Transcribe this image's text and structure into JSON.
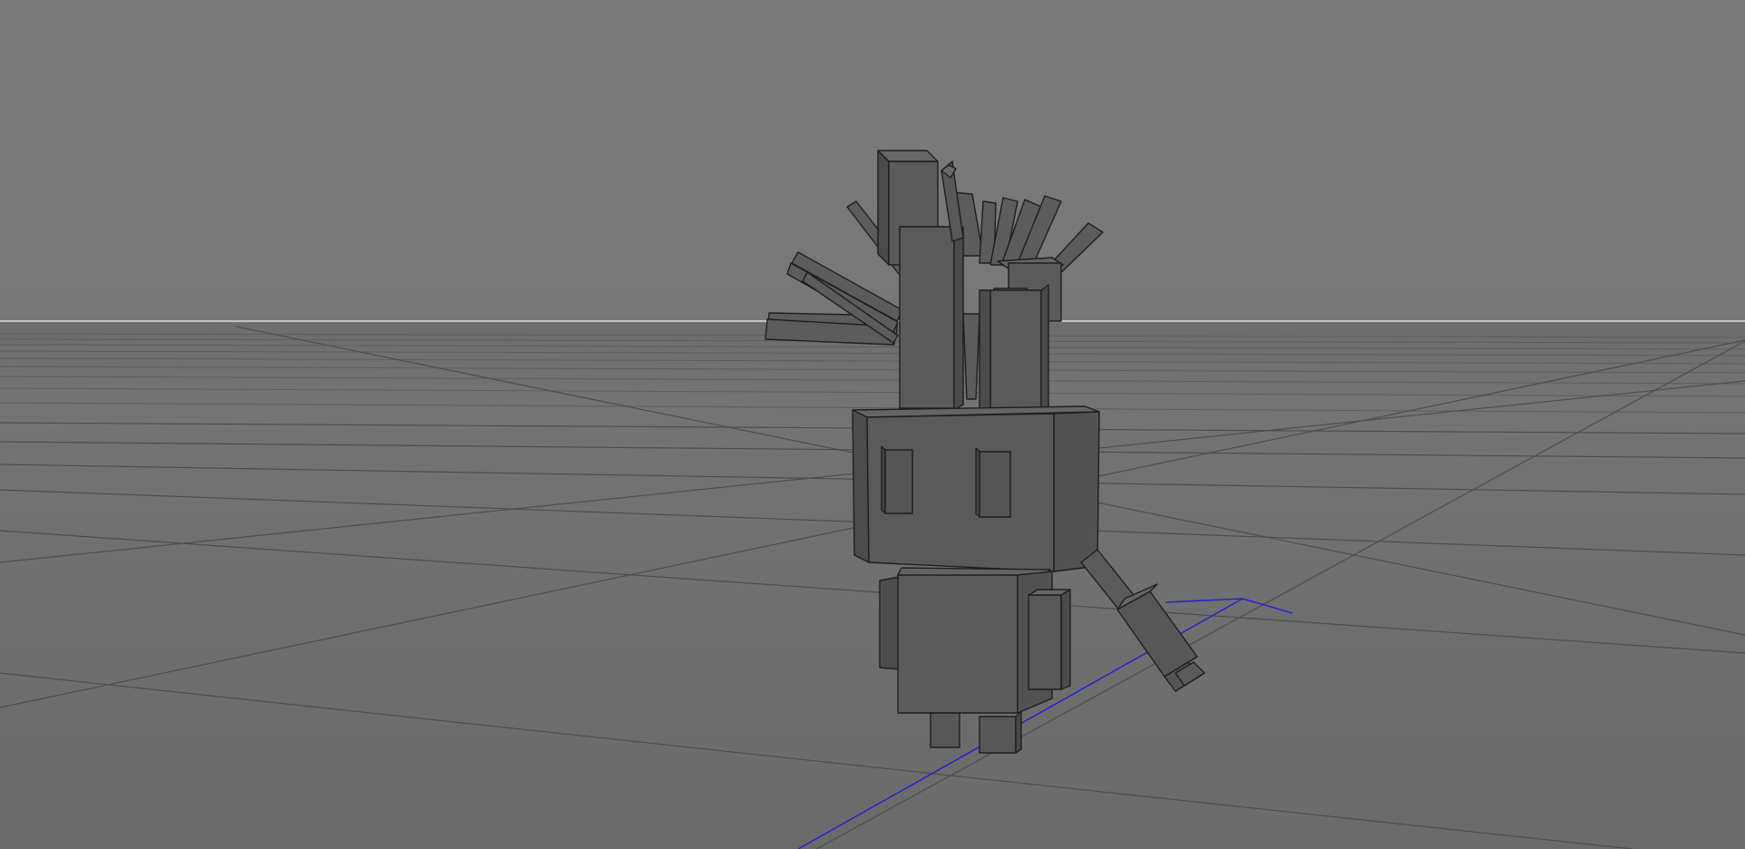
{
  "viewport": {
    "kind": "3d-viewport",
    "projection": "perspective",
    "background_top": "#7b7b7b",
    "background_bottom": "#6c6c6c",
    "horizon_color": "#dcdcdc",
    "grid_line_color": "#4c4c4c",
    "grid_visible": true
  },
  "scene": {
    "object_name": "",
    "object_style": "blocky voxel character (wireframe on shaded)",
    "body_color": "#5a5a5a",
    "face_light": "#606060",
    "face_dark": "#4a4a4a",
    "edge_color": "#1e1e1e",
    "selection_gizmo_color": "#2222cc",
    "selection_gizmo_visible": true
  }
}
